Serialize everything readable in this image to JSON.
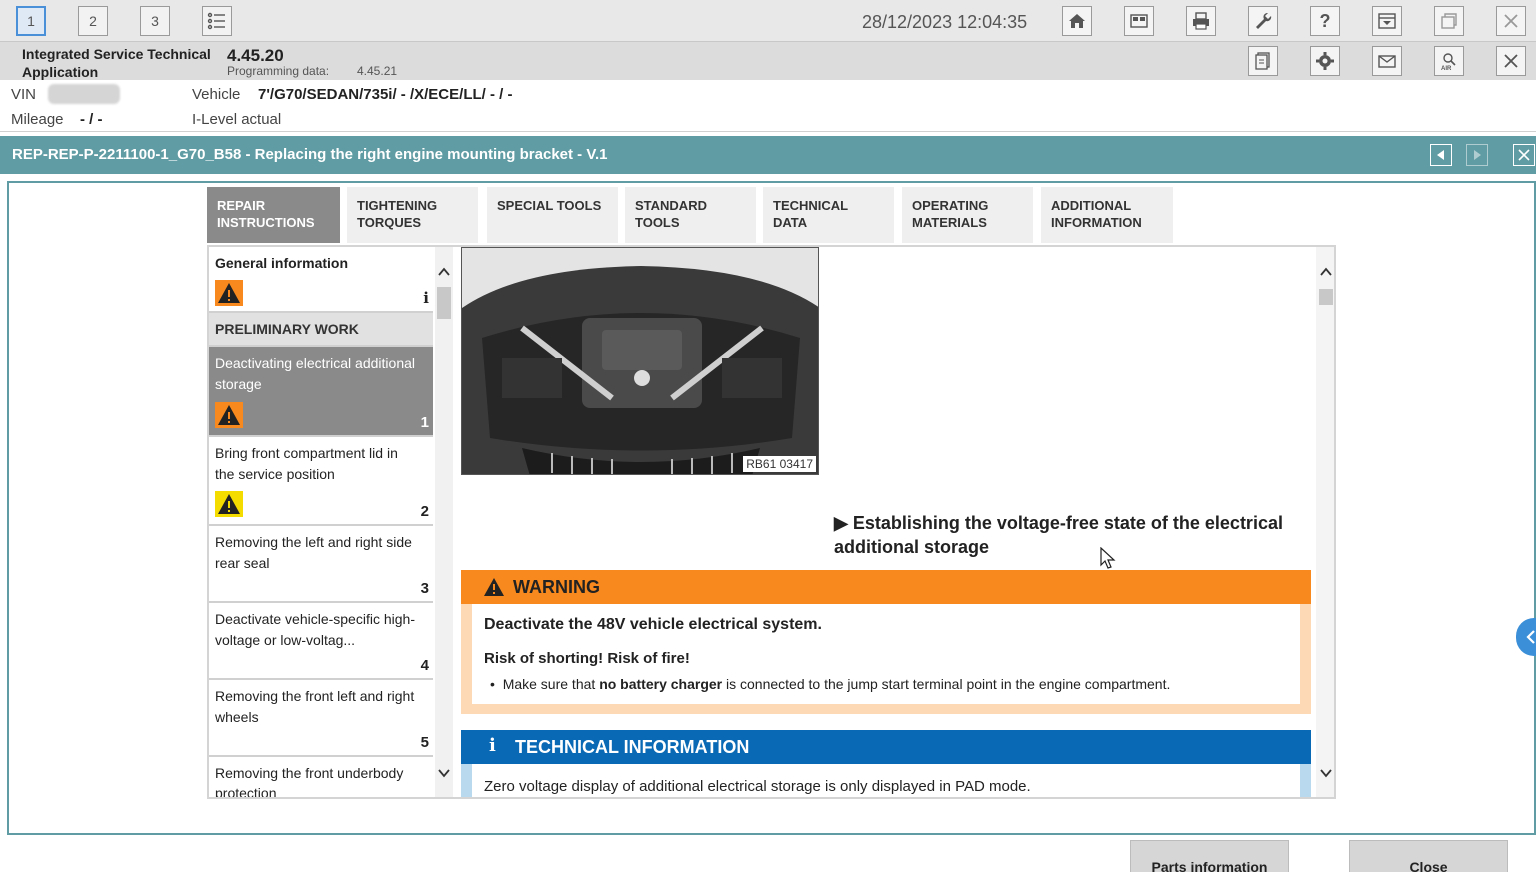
{
  "topbar": {
    "tabs": [
      "1",
      "2",
      "3"
    ],
    "active_tab": "1",
    "datetime": "28/12/2023 12:04:35",
    "icons": [
      "list-icon",
      "home-icon",
      "screen-split-icon",
      "print-icon",
      "wrench-icon",
      "help-icon",
      "dropdown-menu-icon",
      "window-restore-icon",
      "close-icon"
    ]
  },
  "info": {
    "app_name": "Integrated Service Technical Application",
    "version": "4.45.20",
    "programming_label": "Programming data:",
    "programming_value": "4.45.21",
    "icons": [
      "document-icon",
      "settings-gear-icon",
      "envelope-icon",
      "air-search-icon",
      "close-icon"
    ]
  },
  "vehicle": {
    "vin_label": "VIN",
    "vehicle_label": "Vehicle",
    "vehicle_value": "7'/G70/SEDAN/735i/ - /X/ECE/LL/ - / -",
    "mileage_label": "Mileage",
    "mileage_value": "- / -",
    "ilevel_label": "I-Level actual"
  },
  "document": {
    "title": "REP-REP-P-2211100-1_G70_B58 - Replacing the right engine mounting bracket - V.1"
  },
  "tabs": [
    {
      "line1": "REPAIR",
      "line2": "INSTRUCTIONS",
      "active": true
    },
    {
      "line1": "TIGHTENING",
      "line2": "TORQUES",
      "active": false
    },
    {
      "line1": "SPECIAL TOOLS",
      "line2": "",
      "active": false
    },
    {
      "line1": "STANDARD",
      "line2": "TOOLS",
      "active": false
    },
    {
      "line1": "TECHNICAL",
      "line2": "DATA",
      "active": false
    },
    {
      "line1": "OPERATING",
      "line2": "MATERIALS",
      "active": false
    },
    {
      "line1": "ADDITIONAL",
      "line2": "INFORMATION",
      "active": false
    }
  ],
  "nav": {
    "general": {
      "title": "General information",
      "marker": "i"
    },
    "preliminary_header": "PRELIMINARY WORK",
    "items": [
      {
        "title": "Deactivating electrical additional storage",
        "number": "1",
        "warning": "orange"
      },
      {
        "title": "Bring front compartment lid in the service position",
        "number": "2",
        "warning": "yellow"
      },
      {
        "title": "Removing the left and right side rear seal",
        "number": "3"
      },
      {
        "title": "Deactivate vehicle-specific high-voltage or low-voltag...",
        "number": "4"
      },
      {
        "title": "Removing the front left and right wheels",
        "number": "5"
      },
      {
        "title": "Removing the front underbody protection",
        "number": ""
      }
    ]
  },
  "content": {
    "image_ref": "RB61 03417",
    "section_heading": "▶ Establishing the voltage-free state of the electrical additional storage",
    "warning": {
      "label": "WARNING",
      "line1": "Deactivate the 48V vehicle electrical system.",
      "line2": "Risk of shorting! Risk of fire!",
      "bullet_pre": "Make sure that ",
      "bullet_bold": "no battery charger",
      "bullet_post": " is connected to the jump start terminal point in the engine compartment."
    },
    "tech_info": {
      "label": "TECHNICAL INFORMATION",
      "line1": "Zero voltage display of additional electrical storage is only displayed in PAD mode."
    }
  },
  "buttons": {
    "parts": "Parts information",
    "close": "Close"
  },
  "colors": {
    "teal": "#5f9ca3",
    "warning_orange": "#f7891e",
    "info_blue": "#0a69b4"
  }
}
